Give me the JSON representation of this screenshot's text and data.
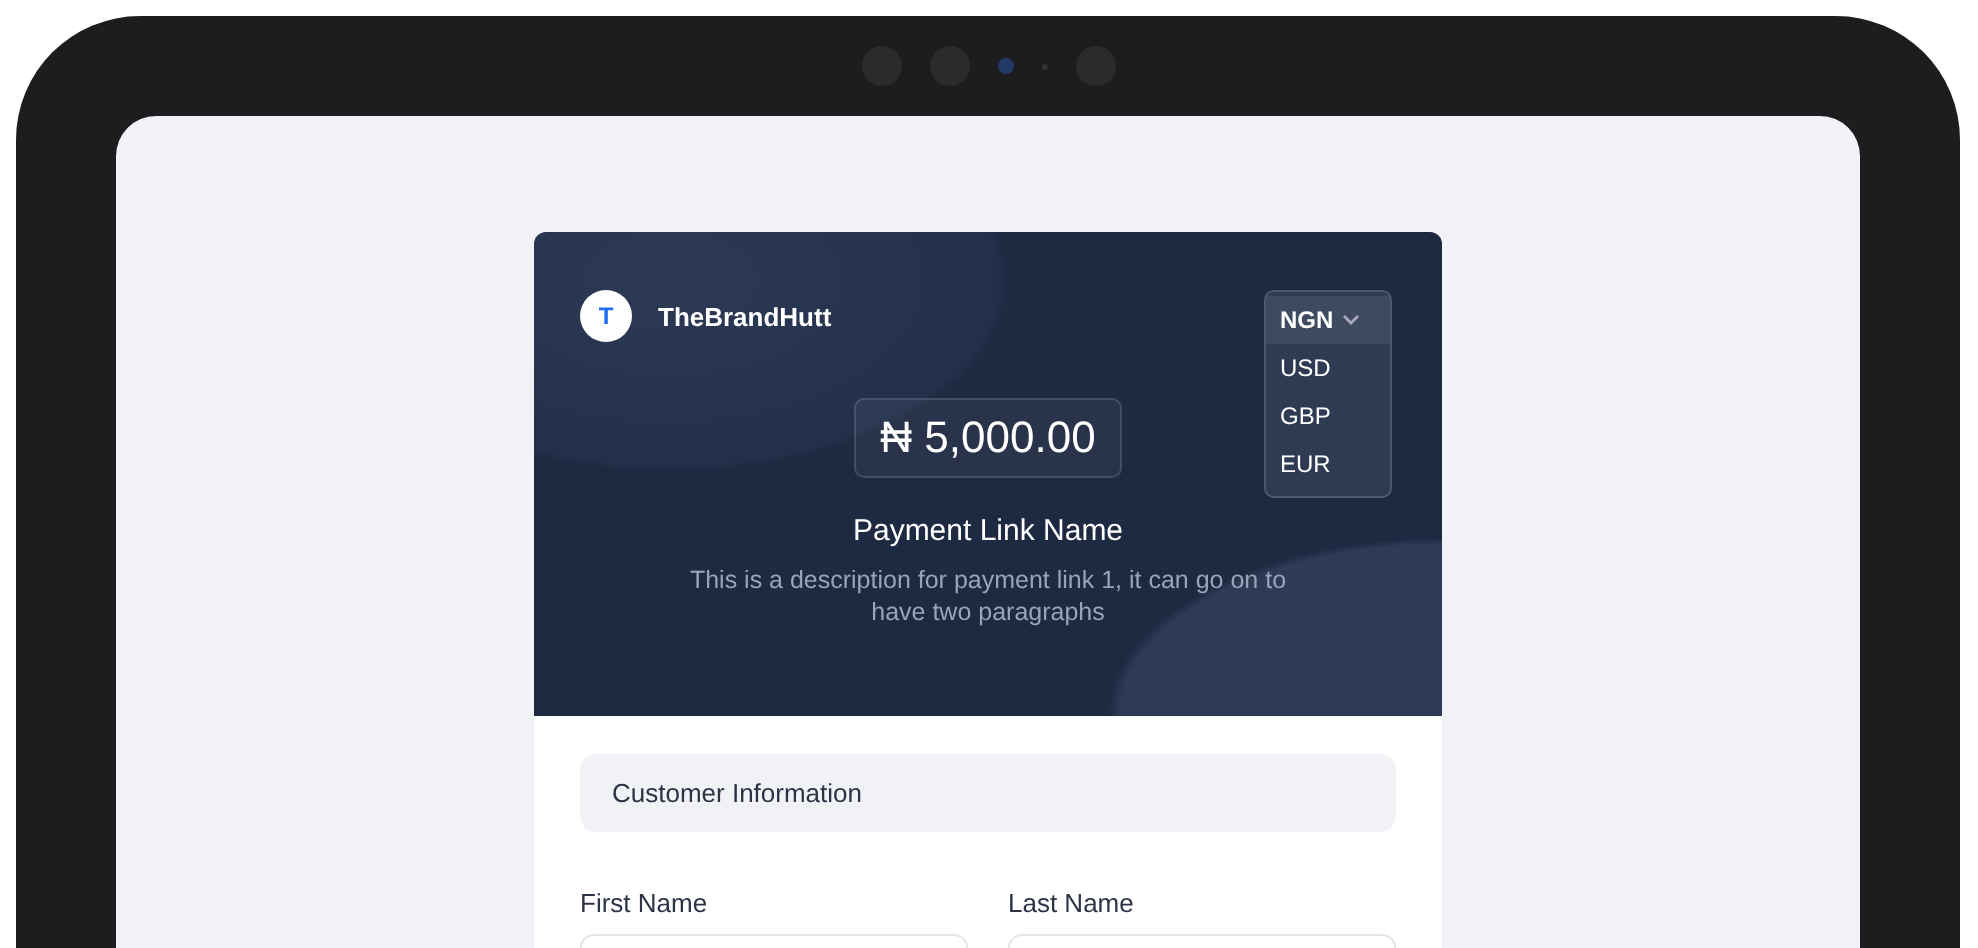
{
  "brand": {
    "initial": "T",
    "name": "TheBrandHutt"
  },
  "currency": {
    "options": [
      {
        "label": "NGN",
        "selected": true
      },
      {
        "label": "USD",
        "selected": false
      },
      {
        "label": "GBP",
        "selected": false
      },
      {
        "label": "EUR",
        "selected": false
      }
    ]
  },
  "amount": "₦ 5,000.00",
  "title": "Payment Link Name",
  "description": "This is a description for payment link 1, it can go on to have two paragraphs",
  "section_title": "Customer Information",
  "fields": [
    {
      "label": "First Name"
    },
    {
      "label": "Last Name"
    }
  ]
}
